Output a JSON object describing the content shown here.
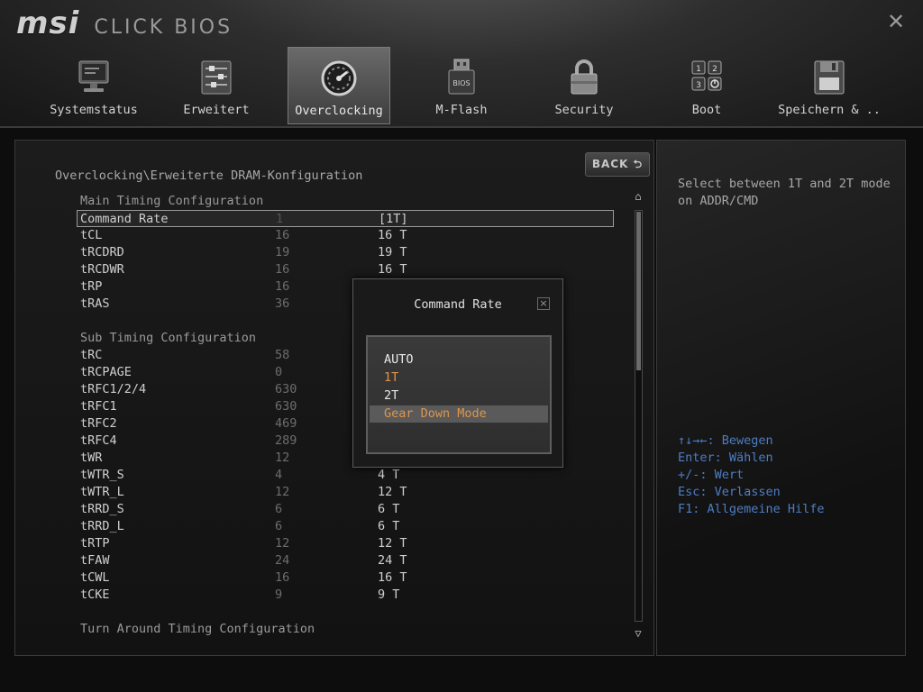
{
  "header": {
    "brand_logo": "msi",
    "brand_product": "CLICK BIOS",
    "close_symbol": "✕",
    "tabs": [
      {
        "label": "Systemstatus",
        "icon": "monitor-icon",
        "active": false
      },
      {
        "label": "Erweitert",
        "icon": "settings-sliders-icon",
        "active": false
      },
      {
        "label": "Overclocking",
        "icon": "speedometer-icon",
        "active": true
      },
      {
        "label": "M-Flash",
        "icon": "usb-bios-icon",
        "active": false
      },
      {
        "label": "Security",
        "icon": "lock-icon",
        "active": false
      },
      {
        "label": "Boot",
        "icon": "boot-keys-icon",
        "active": false
      },
      {
        "label": "Speichern & ..",
        "icon": "floppy-disk-icon",
        "active": false
      }
    ]
  },
  "main": {
    "back_label": "BACK",
    "breadcrumb": "Overclocking\\Erweiterte DRAM-Konfiguration",
    "section_main": "Main Timing Configuration",
    "main_rows": [
      {
        "name": "Command Rate",
        "current": "1",
        "value": "[1T]",
        "selected": true
      },
      {
        "name": "tCL",
        "current": "16",
        "value": "16 T"
      },
      {
        "name": "tRCDRD",
        "current": "19",
        "value": "19 T"
      },
      {
        "name": "tRCDWR",
        "current": "16",
        "value": "16 T"
      },
      {
        "name": "tRP",
        "current": "16",
        "value": ""
      },
      {
        "name": "tRAS",
        "current": "36",
        "value": ""
      }
    ],
    "section_sub": "Sub Timing Configuration",
    "sub_rows": [
      {
        "name": "tRC",
        "current": "58",
        "value": ""
      },
      {
        "name": "tRCPAGE",
        "current": "0",
        "value": ""
      },
      {
        "name": "tRFC1/2/4",
        "current": "630",
        "value": ""
      },
      {
        "name": "tRFC1",
        "current": "630",
        "value": ""
      },
      {
        "name": "tRFC2",
        "current": "469",
        "value": ""
      },
      {
        "name": "tRFC4",
        "current": "289",
        "value": ""
      },
      {
        "name": "tWR",
        "current": "12",
        "value": ""
      },
      {
        "name": "tWTR_S",
        "current": "4",
        "value": "4 T"
      },
      {
        "name": "tWTR_L",
        "current": "12",
        "value": "12 T"
      },
      {
        "name": "tRRD_S",
        "current": "6",
        "value": "6 T"
      },
      {
        "name": "tRRD_L",
        "current": "6",
        "value": "6 T"
      },
      {
        "name": "tRTP",
        "current": "12",
        "value": "12 T"
      },
      {
        "name": "tFAW",
        "current": "24",
        "value": "24 T"
      },
      {
        "name": "tCWL",
        "current": "16",
        "value": "16 T"
      },
      {
        "name": "tCKE",
        "current": "9",
        "value": "9 T"
      }
    ],
    "section_turn": "Turn Around Timing Configuration",
    "scroll_up_symbol": "⌂",
    "scroll_down_symbol": "▽"
  },
  "help": {
    "description": "Select between 1T and 2T mode on ADDR/CMD",
    "keys": [
      "↑↓→←: Bewegen",
      "Enter: Wählen",
      "+/-: Wert",
      "Esc: Verlassen",
      "F1: Allgemeine Hilfe"
    ]
  },
  "dialog": {
    "title": "Command Rate",
    "close_symbol": "×",
    "options": [
      {
        "label": "AUTO",
        "state": "normal"
      },
      {
        "label": "1T",
        "state": "active"
      },
      {
        "label": "2T",
        "state": "normal"
      },
      {
        "label": "Gear Down Mode",
        "state": "highlight"
      }
    ]
  },
  "colors": {
    "accent_orange": "#e0954a",
    "help_blue": "#4d7dc4"
  }
}
